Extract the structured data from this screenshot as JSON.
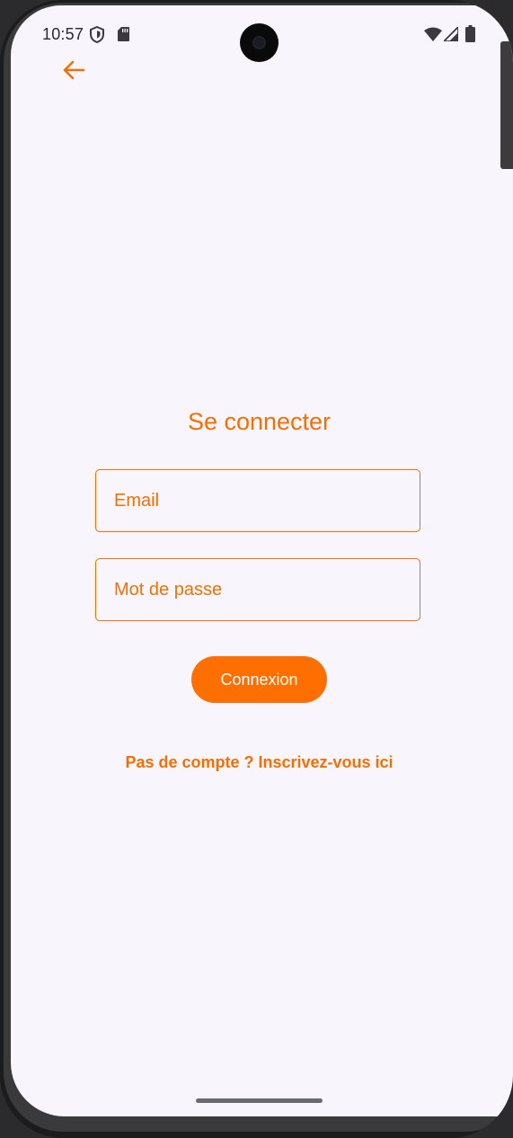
{
  "status_bar": {
    "time": "10:57",
    "icons": [
      "shield-icon",
      "sd-card-icon",
      "wifi-icon",
      "signal-icon",
      "battery-icon"
    ]
  },
  "navigation": {
    "back_icon": "arrow-left-icon"
  },
  "login": {
    "title": "Se connecter",
    "email_placeholder": "Email",
    "email_value": "",
    "password_placeholder": "Mot de passe",
    "password_value": "",
    "submit_label": "Connexion",
    "signup_link": "Pas de compte ? Inscrivez-vous ici"
  },
  "colors": {
    "accent": "#f56f00",
    "button": "#ff6f00",
    "background": "#f8f6fc"
  }
}
